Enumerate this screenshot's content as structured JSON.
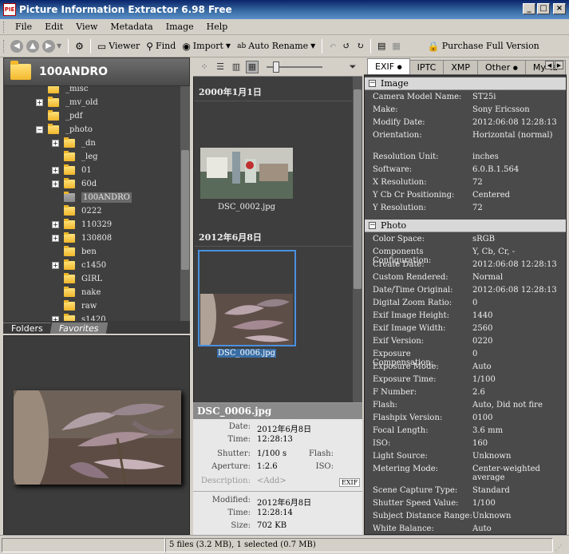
{
  "window": {
    "title": "Picture Information Extractor 6.98 Free",
    "app_icon_text": "PIE"
  },
  "menu": [
    "File",
    "Edit",
    "View",
    "Metadata",
    "Image",
    "Help"
  ],
  "toolbar": {
    "viewer": "Viewer",
    "find": "Find",
    "import": "Import",
    "auto_rename": "Auto Rename",
    "purchase": "Purchase Full Version"
  },
  "folder_header": "100ANDRO",
  "tree": [
    {
      "label": "_misc",
      "level": 1,
      "expander": false
    },
    {
      "label": "_mv_old",
      "level": 1,
      "expander": true
    },
    {
      "label": "_pdf",
      "level": 1,
      "expander": false
    },
    {
      "label": "_photo",
      "level": 1,
      "expander": true,
      "expanded": true
    },
    {
      "label": "_dn",
      "level": 2,
      "expander": true
    },
    {
      "label": "_leg",
      "level": 2,
      "expander": false
    },
    {
      "label": "01",
      "level": 2,
      "expander": true
    },
    {
      "label": "60d",
      "level": 2,
      "expander": true
    },
    {
      "label": "100ANDRO",
      "level": 2,
      "expander": false,
      "selected": true
    },
    {
      "label": "0222",
      "level": 2,
      "expander": false
    },
    {
      "label": "110329",
      "level": 2,
      "expander": true
    },
    {
      "label": "130808",
      "level": 2,
      "expander": true
    },
    {
      "label": "ben",
      "level": 2,
      "expander": false
    },
    {
      "label": "c1450",
      "level": 2,
      "expander": true
    },
    {
      "label": "GIRL",
      "level": 2,
      "expander": false
    },
    {
      "label": "nake",
      "level": 2,
      "expander": false
    },
    {
      "label": "raw",
      "level": 2,
      "expander": false
    },
    {
      "label": "s1420",
      "level": 2,
      "expander": true
    }
  ],
  "left_tabs": [
    "Folders",
    "Favorites"
  ],
  "browser": {
    "groups": [
      {
        "date": "2000年1月1日",
        "file": "DSC_0002.jpg"
      },
      {
        "date": "2012年6月8日",
        "file": "DSC_0006.jpg"
      }
    ]
  },
  "info": {
    "filename": "DSC_0006.jpg",
    "date_label": "Date:",
    "date": "2012年6月8日",
    "time_label": "Time:",
    "time": "12:28:13",
    "shutter_label": "Shutter:",
    "shutter": "1/100 s",
    "flash_label": "Flash:",
    "aperture_label": "Aperture:",
    "aperture": "1:2.6",
    "iso_label": "ISO:",
    "description_label": "Description:",
    "description": "<Add>",
    "exif_badge": "EXIF",
    "modified_label": "Modified:",
    "modified_date": "2012年6月8日",
    "mtime_label": "Time:",
    "mtime": "12:28:14",
    "size_label": "Size:",
    "size": "702 KB"
  },
  "right_tabs": [
    "EXIF",
    "IPTC",
    "XMP",
    "Other",
    "My Ta"
  ],
  "sections": [
    {
      "title": "Image",
      "rows": [
        [
          "Camera Model Name:",
          "ST25i"
        ],
        [
          "Make:",
          "Sony Ericsson"
        ],
        [
          "Modify Date:",
          "2012:06:08 12:28:13"
        ],
        [
          "Orientation:",
          "Horizontal (normal)"
        ],
        [
          "Resolution Unit:",
          "inches"
        ],
        [
          "Software:",
          "6.0.B.1.564"
        ],
        [
          "X Resolution:",
          "72"
        ],
        [
          "Y Cb Cr Positioning:",
          "Centered"
        ],
        [
          "Y Resolution:",
          "72"
        ]
      ]
    },
    {
      "title": "Photo",
      "rows": [
        [
          "Color Space:",
          "sRGB"
        ],
        [
          "Components Configuration:",
          "Y, Cb, Cr, -"
        ],
        [
          "Create Date:",
          "2012:06:08 12:28:13"
        ],
        [
          "Custom Rendered:",
          "Normal"
        ],
        [
          "Date/Time Original:",
          "2012:06:08 12:28:13"
        ],
        [
          "Digital Zoom Ratio:",
          "0"
        ],
        [
          "Exif Image Height:",
          "1440"
        ],
        [
          "Exif Image Width:",
          "2560"
        ],
        [
          "Exif Version:",
          "0220"
        ],
        [
          "Exposure Compensation:",
          "0"
        ],
        [
          "Exposure Mode:",
          "Auto"
        ],
        [
          "Exposure Time:",
          "1/100"
        ],
        [
          "F Number:",
          "2.6"
        ],
        [
          "Flash:",
          "Auto, Did not fire"
        ],
        [
          "Flashpix Version:",
          "0100"
        ],
        [
          "Focal Length:",
          "3.6 mm"
        ],
        [
          "ISO:",
          "160"
        ],
        [
          "Light Source:",
          "Unknown"
        ],
        [
          "Metering Mode:",
          "Center-weighted average"
        ],
        [
          "Scene Capture Type:",
          "Standard"
        ],
        [
          "Shutter Speed Value:",
          "1/100"
        ],
        [
          "Subject Distance Range:",
          "Unknown"
        ],
        [
          "White Balance:",
          "Auto"
        ]
      ]
    }
  ],
  "status": "5 files (3.2 MB), 1 selected (0.7 MB)"
}
